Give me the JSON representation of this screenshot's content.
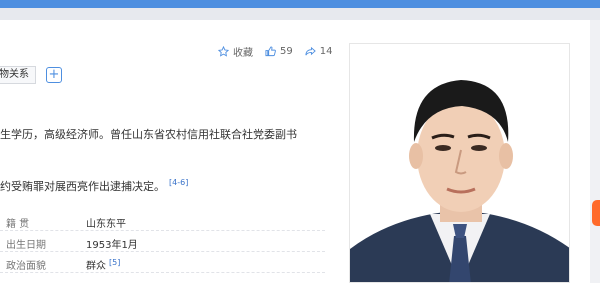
{
  "header": {
    "favorite_label": "收藏",
    "like_count": "59",
    "share_count": "14"
  },
  "tags": {
    "relation_label": "物关系",
    "add_symbol": "+"
  },
  "intro": {
    "line1": "生学历，高级经济师。曾任山东省农村信用社联合社党委副书",
    "line2": "约受贿罪对展西亮作出逮捕决定。",
    "line2_ref": "[4-6]"
  },
  "info": {
    "rows": [
      {
        "key": "籍    贯",
        "value": "山东东平",
        "ref": ""
      },
      {
        "key": "出生日期",
        "value": "1953年1月",
        "ref": ""
      },
      {
        "key": "政治面貌",
        "value": "群众",
        "ref": "[5]"
      }
    ]
  },
  "colors": {
    "accent": "#4e8fe0",
    "link": "#3a73c9",
    "scroll_handle": "#ff6a2a",
    "suit": "#2b3a55"
  },
  "icons": {
    "favorite": "star-icon",
    "like": "thumbs-up-icon",
    "share": "share-icon",
    "add": "plus-icon"
  }
}
